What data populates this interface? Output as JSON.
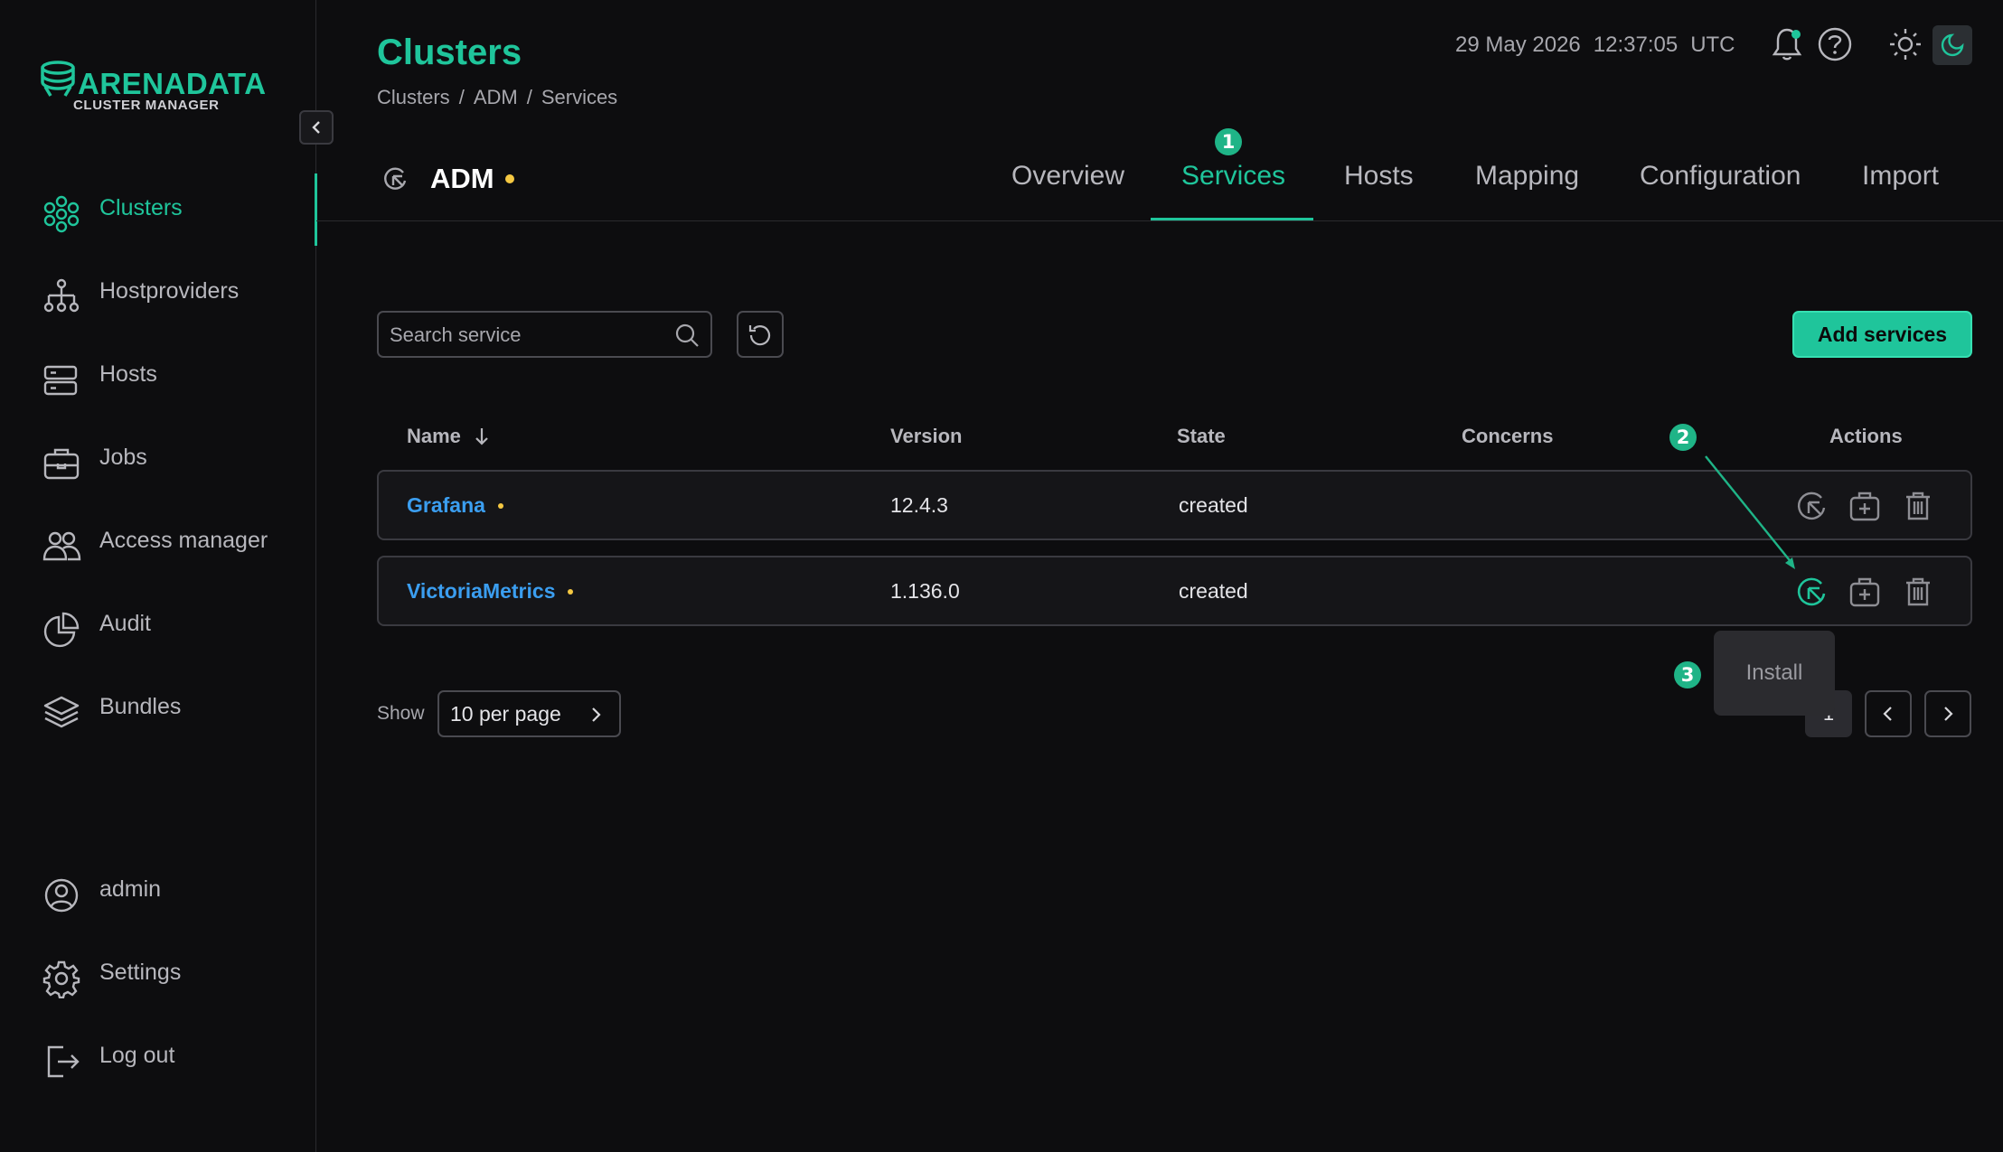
{
  "brand": {
    "name": "ARENADATA",
    "subtitle": "CLUSTER MANAGER",
    "accent": "#1fc59b"
  },
  "sidebar": {
    "items": [
      {
        "label": "Clusters",
        "icon": "clusters-icon",
        "active": true
      },
      {
        "label": "Hostproviders",
        "icon": "hostproviders-icon"
      },
      {
        "label": "Hosts",
        "icon": "hosts-icon"
      },
      {
        "label": "Jobs",
        "icon": "jobs-icon"
      },
      {
        "label": "Access manager",
        "icon": "access-manager-icon"
      },
      {
        "label": "Audit",
        "icon": "audit-icon"
      },
      {
        "label": "Bundles",
        "icon": "bundles-icon"
      }
    ],
    "bottom": [
      {
        "label": "admin",
        "icon": "user-icon"
      },
      {
        "label": "Settings",
        "icon": "gear-icon"
      },
      {
        "label": "Log out",
        "icon": "logout-icon"
      }
    ]
  },
  "header": {
    "title": "Clusters",
    "breadcrumb": [
      "Clusters",
      "ADM",
      "Services"
    ],
    "date": "29 May 2026",
    "time": "12:37:05",
    "timezone": "UTC"
  },
  "cluster": {
    "name": "ADM"
  },
  "tabs": [
    "Overview",
    "Services",
    "Hosts",
    "Mapping",
    "Configuration",
    "Import"
  ],
  "active_tab": "Services",
  "toolbar": {
    "search_placeholder": "Search service",
    "add_label": "Add services"
  },
  "table": {
    "columns": [
      "Name",
      "Version",
      "State",
      "Concerns",
      "Actions"
    ],
    "rows": [
      {
        "name": "Grafana",
        "version": "12.4.3",
        "state": "created"
      },
      {
        "name": "VictoriaMetrics",
        "version": "1.136.0",
        "state": "created"
      }
    ]
  },
  "pagination": {
    "show_label": "Show",
    "per_page": "10 per page",
    "current": "1"
  },
  "tooltip": {
    "text": "Install"
  },
  "annotations": [
    "1",
    "2",
    "3"
  ]
}
